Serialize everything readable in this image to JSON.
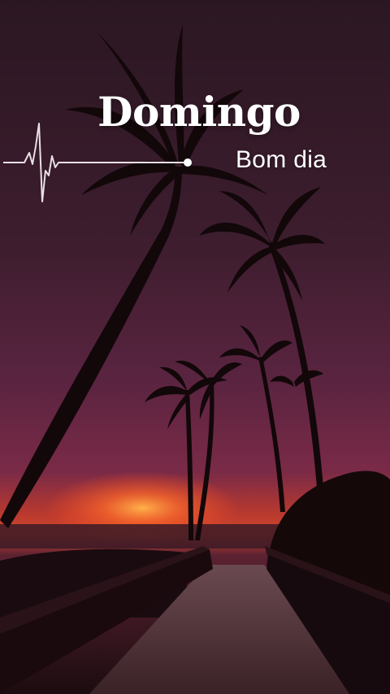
{
  "overlay": {
    "title": "Domingo",
    "subtitle": "Bom dia"
  },
  "icons": {
    "pulse": "heartbeat-line-icon"
  },
  "colors": {
    "sky_top": "#2b1722",
    "sky_mid": "#4a2236",
    "sky_low": "#7a2a47",
    "horizon": "#d2472b",
    "sun": "#ff7a2a",
    "silhouette": "#120709",
    "text": "#ffffff"
  }
}
